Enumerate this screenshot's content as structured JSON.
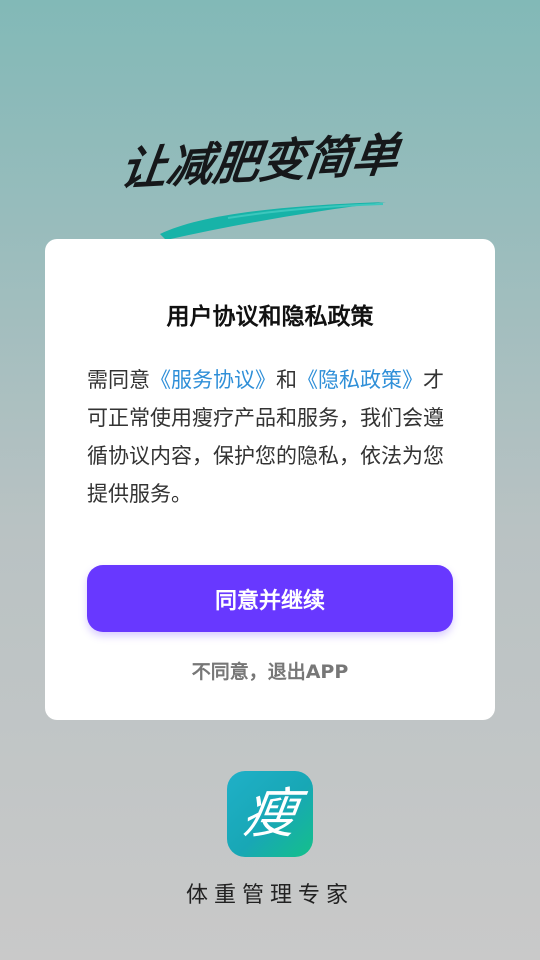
{
  "banner": {
    "slogan": "让减肥变简单"
  },
  "dialog": {
    "title": "用户协议和隐私政策",
    "text_prefix": "需同意",
    "service_link": "《服务协议》",
    "text_and": "和",
    "privacy_link": "《隐私政策》",
    "text_suffix": "才可正常使用瘦疗产品和服务，我们会遵循协议内容，保护您的隐私，依法为您提供服务。",
    "agree_button": "同意并继续",
    "disagree_link": "不同意，退出APP"
  },
  "app": {
    "icon_glyph": "瘦",
    "name": "体重管理专家"
  },
  "colors": {
    "accent": "#6838ff",
    "link": "#2f8fd8",
    "brush": "#17b3a8"
  }
}
